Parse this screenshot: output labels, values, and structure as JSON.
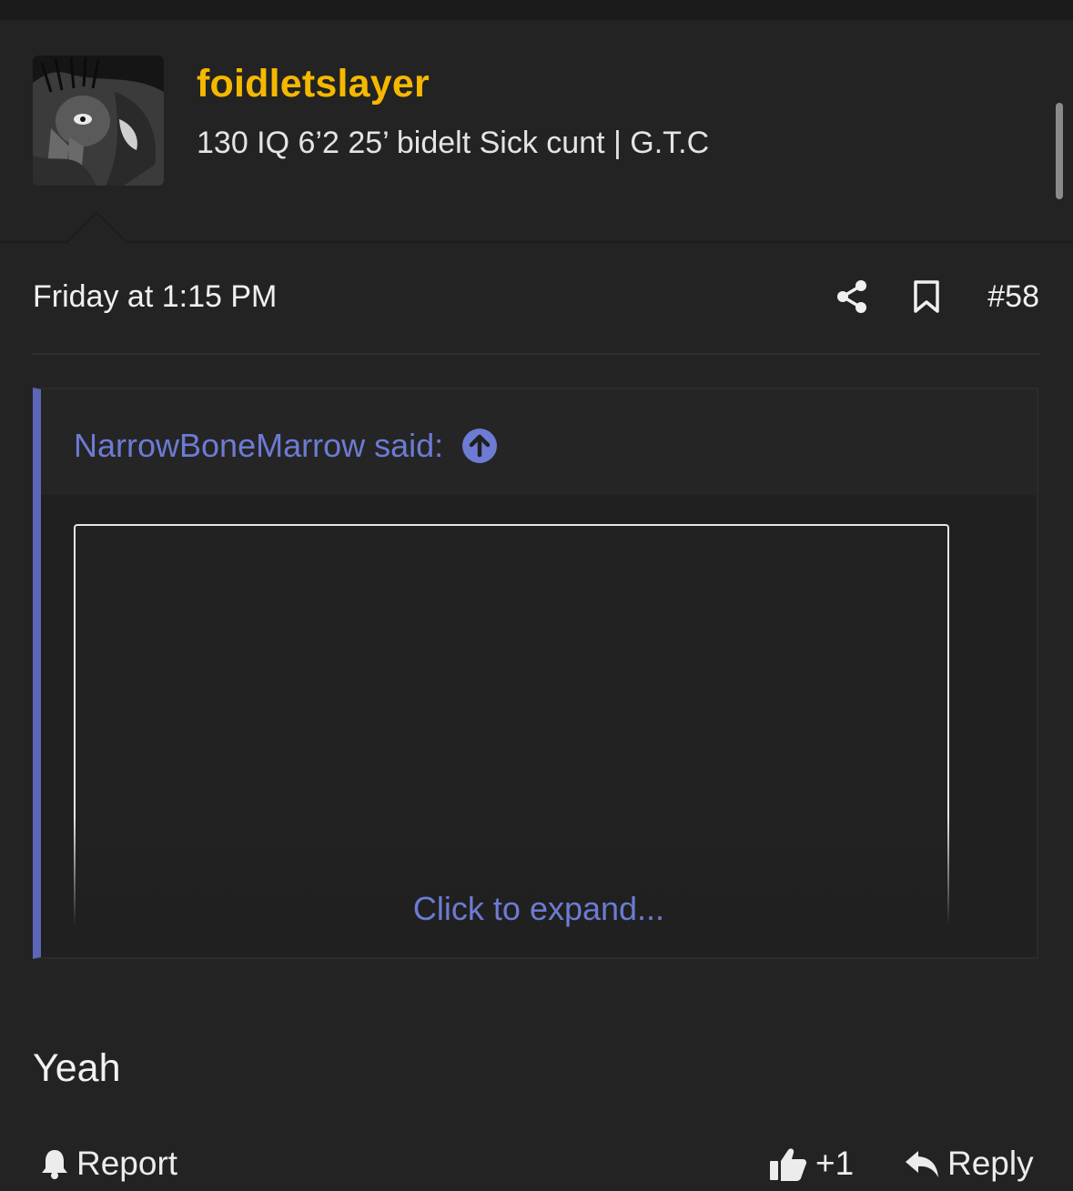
{
  "user": {
    "username": "foidletslayer",
    "title": "130 IQ 6’2 25’ bidelt Sick cunt | G.T.C",
    "avatar_icon": "avatar-image"
  },
  "post": {
    "date": "Friday at 1:15 PM",
    "number": "#58",
    "body": "Yeah",
    "share_icon": "share-icon",
    "bookmark_icon": "bookmark-icon"
  },
  "quote": {
    "author_label": "NarrowBoneMarrow said:",
    "jump_icon": "arrow-up-circle-icon",
    "expand_label": "Click to expand..."
  },
  "actions": {
    "report_label": "Report",
    "like_count": "+1",
    "reply_label": "Reply"
  },
  "colors": {
    "username": "#f5b800",
    "link": "#6d7bd3",
    "quote_bar": "#5c66b8",
    "background": "#232323"
  }
}
